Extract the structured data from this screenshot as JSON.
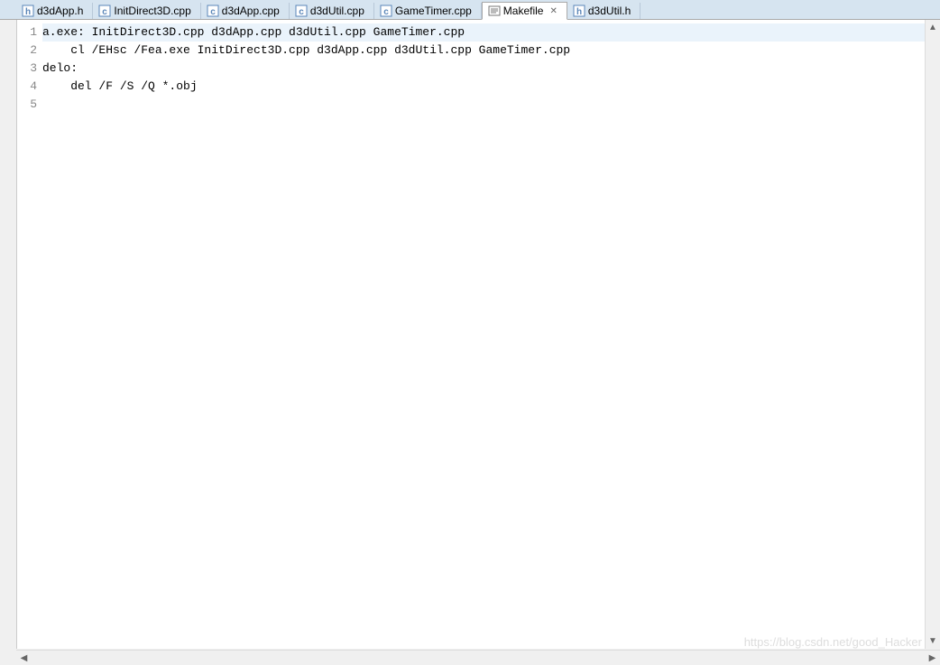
{
  "tabs": [
    {
      "label": "d3dApp.h",
      "iconType": "h",
      "active": false
    },
    {
      "label": "InitDirect3D.cpp",
      "iconType": "c",
      "active": false
    },
    {
      "label": "d3dApp.cpp",
      "iconType": "c",
      "active": false
    },
    {
      "label": "d3dUtil.cpp",
      "iconType": "c",
      "active": false
    },
    {
      "label": "GameTimer.cpp",
      "iconType": "c",
      "active": false
    },
    {
      "label": "Makefile",
      "iconType": "m",
      "active": true
    },
    {
      "label": "d3dUtil.h",
      "iconType": "h",
      "active": false
    }
  ],
  "closeGlyph": "✕",
  "lineNumbers": [
    "1",
    "2",
    "3",
    "4",
    "5"
  ],
  "codeLines": [
    "a.exe: InitDirect3D.cpp d3dApp.cpp d3dUtil.cpp GameTimer.cpp",
    "    cl /EHsc /Fea.exe InitDirect3D.cpp d3dApp.cpp d3dUtil.cpp GameTimer.cpp",
    "delo:",
    "    del /F /S /Q *.obj",
    ""
  ],
  "highlightedLine": 0,
  "watermark": "https://blog.csdn.net/good_Hacker",
  "scroll": {
    "up": "▲",
    "down": "▼",
    "left": "◀",
    "right": "▶"
  }
}
